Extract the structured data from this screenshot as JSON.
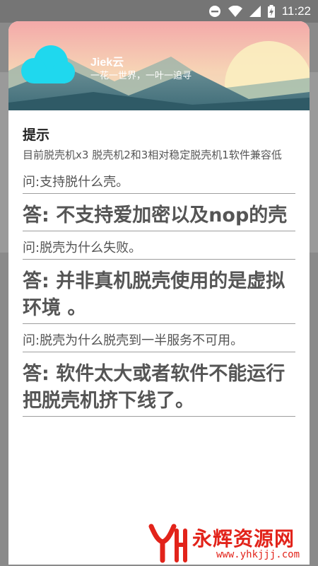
{
  "status_bar": {
    "time": "11:22"
  },
  "dialog": {
    "app_name": "Jiek云",
    "slogan": "一花一世界，一叶一追寻",
    "title": "提示",
    "notice": "目前脱壳机x3 脱壳机2和3相对稳定脱壳机1软件兼容低",
    "qa": [
      {
        "q": "问:支持脱什么壳。",
        "a": "答: 不支持爱加密以及nop的壳"
      },
      {
        "q": "问:脱壳为什么失败。",
        "a": "答: 并非真机脱壳使用的是虚拟环境 。"
      },
      {
        "q": "问:脱壳为什么脱壳到一半服务不可用。",
        "a": "答: 软件太大或者软件不能运行把脱壳机挤下线了。"
      }
    ]
  },
  "watermark": {
    "text": "永辉资源网",
    "url": "www.yhkjjj.com"
  },
  "colors": {
    "watermark_red": "#e2231a",
    "logo_cyan": "#1fd8ee"
  }
}
